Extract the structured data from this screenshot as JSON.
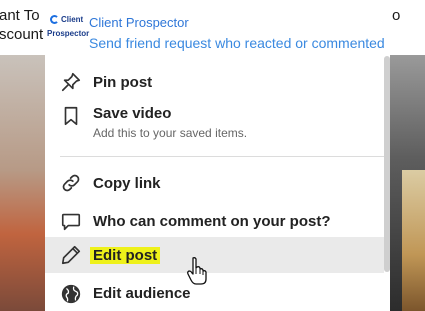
{
  "background": {
    "text_line1": "ant To",
    "text_line2": "scount",
    "text_right": "o"
  },
  "extension": {
    "logo_word1": "Client",
    "logo_word2": "Prospector",
    "title": "Client Prospector",
    "subtitle": "Send friend request who reacted or commented"
  },
  "menu": {
    "items": [
      {
        "label": "Pin post",
        "icon": "pin-icon"
      },
      {
        "label": "Save video",
        "sub": "Add this to your saved items.",
        "icon": "bookmark-icon"
      },
      {
        "label": "Copy link",
        "icon": "link-icon"
      },
      {
        "label": "Who can comment on your post?",
        "icon": "comment-icon"
      },
      {
        "label": "Edit post",
        "icon": "pencil-icon",
        "highlight": "#eef11a"
      },
      {
        "label": "Edit audience",
        "icon": "globe-icon"
      }
    ]
  },
  "colors": {
    "extension_text": "#2f77d8",
    "highlight": "#eef11a",
    "hover_row": "#eaeaea"
  }
}
